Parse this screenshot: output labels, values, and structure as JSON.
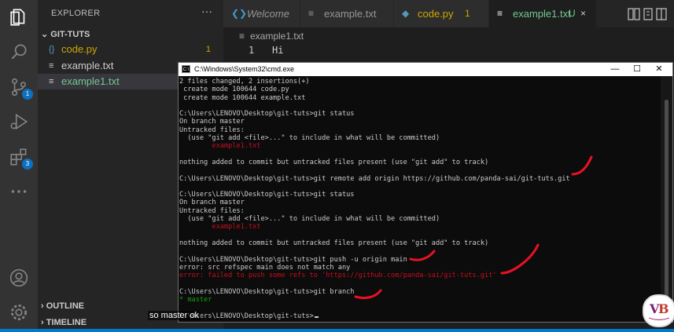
{
  "activity_bar": {
    "items": [
      {
        "icon": "files-icon"
      },
      {
        "icon": "search-icon"
      },
      {
        "icon": "source-control-icon",
        "badge": "1"
      },
      {
        "icon": "run-debug-icon"
      },
      {
        "icon": "extensions-icon",
        "badge": "3"
      },
      {
        "icon": "more-icon"
      }
    ],
    "bottom": [
      {
        "icon": "account-icon"
      },
      {
        "icon": "settings-gear-icon"
      }
    ]
  },
  "sidebar": {
    "title": "EXPLORER",
    "more": "···",
    "folder": "GIT-TUTS",
    "files": [
      {
        "name": "code.py",
        "badge": "1",
        "color": "#cca700",
        "icon_color": "#519aba",
        "icon": "{}"
      },
      {
        "name": "example.txt",
        "badge": "",
        "color": "#cccccc",
        "icon_color": "#cccccc",
        "icon": "≡"
      },
      {
        "name": "example1.txt",
        "badge": "",
        "color": "#73c991",
        "icon_color": "#cccccc",
        "icon": "≡"
      }
    ],
    "outline": "OUTLINE",
    "timeline": "TIMELINE"
  },
  "tabs": [
    {
      "label": "Welcome",
      "mark": "",
      "icon": "vscode-icon"
    },
    {
      "label": "example.txt",
      "mark": "",
      "icon": "text-file-icon"
    },
    {
      "label": "code.py",
      "mark": "1",
      "icon": "python-icon"
    },
    {
      "label": "example1.txt",
      "mark": "U",
      "icon": "text-file-icon"
    }
  ],
  "breadcrumb": "example1.txt",
  "editor": {
    "line_number": "1",
    "text": "Hi"
  },
  "cmd": {
    "title": "C:\\Windows\\System32\\cmd.exe",
    "minimize": "—",
    "maximize": "☐",
    "close": "✕",
    "lines": [
      {
        "text": "2 files changed, 2 insertions(+)",
        "style": ""
      },
      {
        "text": " create mode 100644 code.py",
        "style": ""
      },
      {
        "text": " create mode 100644 example.txt",
        "style": ""
      },
      {
        "text": "",
        "style": ""
      },
      {
        "text": "C:\\Users\\LENOVO\\Desktop\\git-tuts>git status",
        "style": ""
      },
      {
        "text": "On branch master",
        "style": ""
      },
      {
        "text": "Untracked files:",
        "style": ""
      },
      {
        "text": "  (use \"git add <file>...\" to include in what will be committed)",
        "style": ""
      },
      {
        "text": "        example1.txt",
        "style": "red"
      },
      {
        "text": "",
        "style": ""
      },
      {
        "text": "nothing added to commit but untracked files present (use \"git add\" to track)",
        "style": ""
      },
      {
        "text": "",
        "style": ""
      },
      {
        "text": "C:\\Users\\LENOVO\\Desktop\\git-tuts>git remote add origin https://github.com/panda-sai/git-tuts.git",
        "style": ""
      },
      {
        "text": "",
        "style": ""
      },
      {
        "text": "C:\\Users\\LENOVO\\Desktop\\git-tuts>git status",
        "style": ""
      },
      {
        "text": "On branch master",
        "style": ""
      },
      {
        "text": "Untracked files:",
        "style": ""
      },
      {
        "text": "  (use \"git add <file>...\" to include in what will be committed)",
        "style": ""
      },
      {
        "text": "        example1.txt",
        "style": "red"
      },
      {
        "text": "",
        "style": ""
      },
      {
        "text": "nothing added to commit but untracked files present (use \"git add\" to track)",
        "style": ""
      },
      {
        "text": "",
        "style": ""
      },
      {
        "text": "C:\\Users\\LENOVO\\Desktop\\git-tuts>git push -u origin main",
        "style": ""
      },
      {
        "text": "error: src refspec main does not match any",
        "style": ""
      },
      {
        "text": "error: failed to push some refs to 'https://github.com/panda-sai/git-tuts.git'",
        "style": "red"
      },
      {
        "text": "",
        "style": ""
      },
      {
        "text": "C:\\Users\\LENOVO\\Desktop\\git-tuts>git branch",
        "style": ""
      },
      {
        "text": "* master",
        "style": "green"
      },
      {
        "text": "",
        "style": ""
      },
      {
        "text": "C:\\Users\\LENOVO\\Desktop\\git-tuts>",
        "style": "prompt"
      }
    ]
  },
  "caption": "so master ok",
  "colors": {
    "accent": "#007acc",
    "annotation_red": "#e81123",
    "error_red": "#c50f1f",
    "branch_green": "#13a10e"
  }
}
